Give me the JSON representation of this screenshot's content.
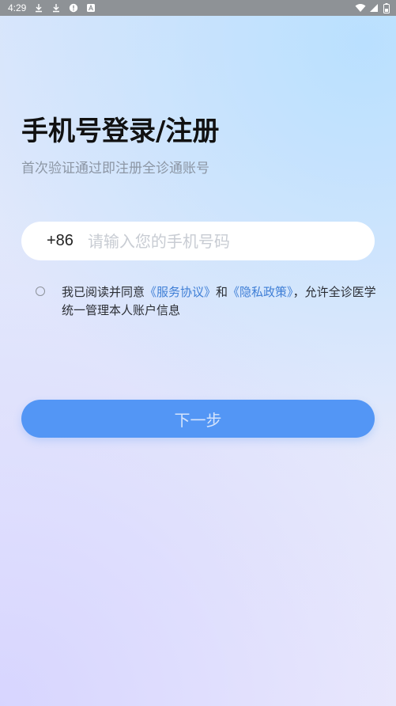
{
  "status_bar": {
    "time": "4:29",
    "left_icons": [
      "download-icon",
      "download-icon",
      "alert-icon",
      "a-icon"
    ],
    "right_icons": [
      "wifi-icon",
      "signal-icon",
      "battery-icon"
    ]
  },
  "login": {
    "title": "手机号登录/注册",
    "subtitle": "首次验证通过即注册全诊通账号",
    "country_code": "+86",
    "phone_placeholder": "请输入您的手机号码",
    "phone_value": ""
  },
  "agreement": {
    "prefix": "我已阅读并同意",
    "service_link": "《服务协议》",
    "conjunction": "和",
    "privacy_link": "《隐私政策》",
    "suffix": "，允许全诊医学统一管理本人账户信息",
    "checked": false
  },
  "next_button": {
    "label": "下一步"
  },
  "colors": {
    "accent": "#5396f5",
    "link": "#3f7fd6",
    "title": "#111111",
    "subtitle": "#8c96a4"
  }
}
